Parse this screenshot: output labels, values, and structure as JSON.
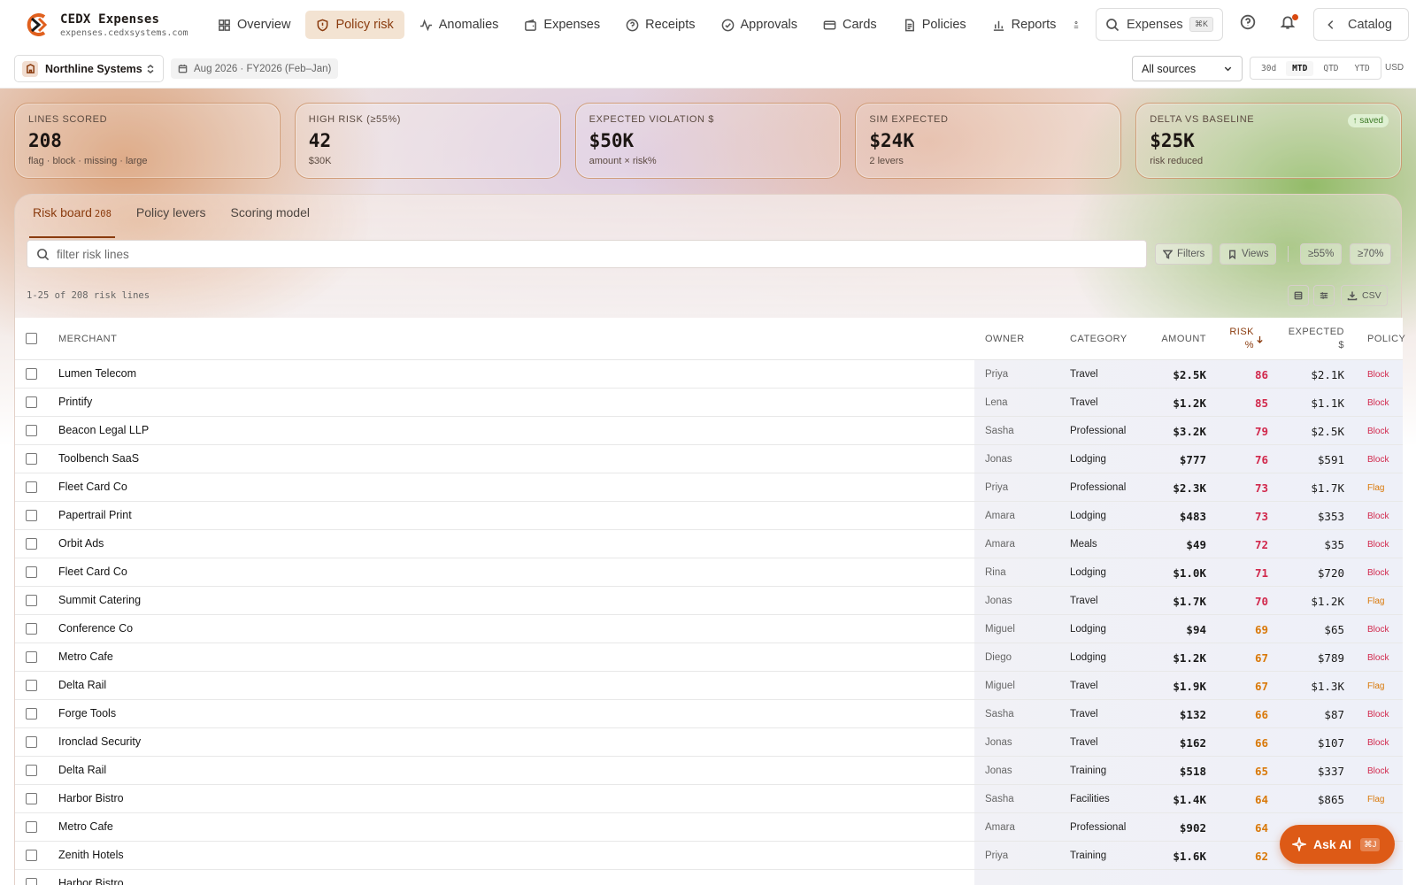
{
  "app": {
    "title": "CEDX Expenses",
    "domain": "expenses.cedxsystems.com"
  },
  "nav": [
    {
      "label": "Overview",
      "icon": "grid-icon",
      "active": false
    },
    {
      "label": "Policy risk",
      "icon": "shield-icon",
      "active": true
    },
    {
      "label": "Anomalies",
      "icon": "activity-icon",
      "active": false
    },
    {
      "label": "Expenses",
      "icon": "wallet-icon",
      "active": false
    },
    {
      "label": "Receipts",
      "icon": "help-circle-icon",
      "active": false
    },
    {
      "label": "Approvals",
      "icon": "check-circle-icon",
      "active": false
    },
    {
      "label": "Cards",
      "icon": "card-icon",
      "active": false
    },
    {
      "label": "Policies",
      "icon": "document-icon",
      "active": false
    },
    {
      "label": "Reports",
      "icon": "bar-chart-icon",
      "active": false
    }
  ],
  "header": {
    "search_label": "Expenses",
    "search_kbd": "⌘K",
    "catalog_label": "Catalog"
  },
  "context": {
    "org": "Northline Systems",
    "period": "Aug 2026 · FY2026 (Feb–Jan)",
    "source": "All sources",
    "ranges": [
      "30d",
      "MTD",
      "QTD",
      "YTD"
    ],
    "active_range": "MTD",
    "currency": "USD"
  },
  "kpis": [
    {
      "label": "LINES SCORED",
      "value": "208",
      "sub": "flag · block · missing · large"
    },
    {
      "label": "HIGH RISK (≥55%)",
      "value": "42",
      "sub": "$30K"
    },
    {
      "label": "EXPECTED VIOLATION $",
      "value": "$50K",
      "sub": "amount × risk%"
    },
    {
      "label": "SIM EXPECTED",
      "value": "$24K",
      "sub": "2 levers"
    },
    {
      "label": "DELTA VS BASELINE",
      "value": "$25K",
      "sub": "risk reduced",
      "badge": "↑ saved"
    }
  ],
  "tabs": [
    {
      "label": "Risk board",
      "count": "208"
    },
    {
      "label": "Policy levers"
    },
    {
      "label": "Scoring model"
    }
  ],
  "toolbar": {
    "filter_placeholder": "filter risk lines",
    "filters_label": "Filters",
    "views_label": "Views",
    "thr1": "≥55%",
    "thr2": "≥70%",
    "count_text": "1-25 of 208 risk lines",
    "csv_label": "CSV"
  },
  "table": {
    "columns": {
      "merchant": "MERCHANT",
      "owner": "OWNER",
      "category": "CATEGORY",
      "amount": "AMOUNT",
      "risk": "RISK %",
      "expected": "EXPECTED $",
      "policy": "POLICY"
    },
    "rows": [
      {
        "merchant": "Lumen Telecom",
        "owner": "Priya",
        "category": "Travel",
        "amount": "$2.5K",
        "risk": "86",
        "expected": "$2.1K",
        "policy": "Block"
      },
      {
        "merchant": "Printify",
        "owner": "Lena",
        "category": "Travel",
        "amount": "$1.2K",
        "risk": "85",
        "expected": "$1.1K",
        "policy": "Block"
      },
      {
        "merchant": "Beacon Legal LLP",
        "owner": "Sasha",
        "category": "Professional",
        "amount": "$3.2K",
        "risk": "79",
        "expected": "$2.5K",
        "policy": "Block"
      },
      {
        "merchant": "Toolbench SaaS",
        "owner": "Jonas",
        "category": "Lodging",
        "amount": "$777",
        "risk": "76",
        "expected": "$591",
        "policy": "Block"
      },
      {
        "merchant": "Fleet Card Co",
        "owner": "Priya",
        "category": "Professional",
        "amount": "$2.3K",
        "risk": "73",
        "expected": "$1.7K",
        "policy": "Flag"
      },
      {
        "merchant": "Papertrail Print",
        "owner": "Amara",
        "category": "Lodging",
        "amount": "$483",
        "risk": "73",
        "expected": "$353",
        "policy": "Block"
      },
      {
        "merchant": "Orbit Ads",
        "owner": "Amara",
        "category": "Meals",
        "amount": "$49",
        "risk": "72",
        "expected": "$35",
        "policy": "Block"
      },
      {
        "merchant": "Fleet Card Co",
        "owner": "Rina",
        "category": "Lodging",
        "amount": "$1.0K",
        "risk": "71",
        "expected": "$720",
        "policy": "Block"
      },
      {
        "merchant": "Summit Catering",
        "owner": "Jonas",
        "category": "Travel",
        "amount": "$1.7K",
        "risk": "70",
        "expected": "$1.2K",
        "policy": "Flag"
      },
      {
        "merchant": "Conference Co",
        "owner": "Miguel",
        "category": "Lodging",
        "amount": "$94",
        "risk": "69",
        "expected": "$65",
        "policy": "Block"
      },
      {
        "merchant": "Metro Cafe",
        "owner": "Diego",
        "category": "Lodging",
        "amount": "$1.2K",
        "risk": "67",
        "expected": "$789",
        "policy": "Block"
      },
      {
        "merchant": "Delta Rail",
        "owner": "Miguel",
        "category": "Travel",
        "amount": "$1.9K",
        "risk": "67",
        "expected": "$1.3K",
        "policy": "Flag"
      },
      {
        "merchant": "Forge Tools",
        "owner": "Sasha",
        "category": "Travel",
        "amount": "$132",
        "risk": "66",
        "expected": "$87",
        "policy": "Block"
      },
      {
        "merchant": "Ironclad Security",
        "owner": "Jonas",
        "category": "Travel",
        "amount": "$162",
        "risk": "66",
        "expected": "$107",
        "policy": "Block"
      },
      {
        "merchant": "Delta Rail",
        "owner": "Jonas",
        "category": "Training",
        "amount": "$518",
        "risk": "65",
        "expected": "$337",
        "policy": "Block"
      },
      {
        "merchant": "Harbor Bistro",
        "owner": "Sasha",
        "category": "Facilities",
        "amount": "$1.4K",
        "risk": "64",
        "expected": "$865",
        "policy": "Flag"
      },
      {
        "merchant": "Metro Cafe",
        "owner": "Amara",
        "category": "Professional",
        "amount": "$902",
        "risk": "64",
        "expected": "",
        "policy": ""
      },
      {
        "merchant": "Zenith Hotels",
        "owner": "Priya",
        "category": "Training",
        "amount": "$1.6K",
        "risk": "62",
        "expected": "",
        "policy": ""
      },
      {
        "merchant": "Harbor Bistro",
        "owner": "",
        "category": "",
        "amount": "",
        "risk": "",
        "expected": "",
        "policy": ""
      }
    ]
  },
  "ask_ai": {
    "label": "Ask AI",
    "kbd": "⌘J"
  },
  "colors": {
    "accent": "#8a3b0e",
    "high_risk": "#d1284c",
    "mid_risk": "#d9790a",
    "ask_ai": "#dd5a16"
  }
}
